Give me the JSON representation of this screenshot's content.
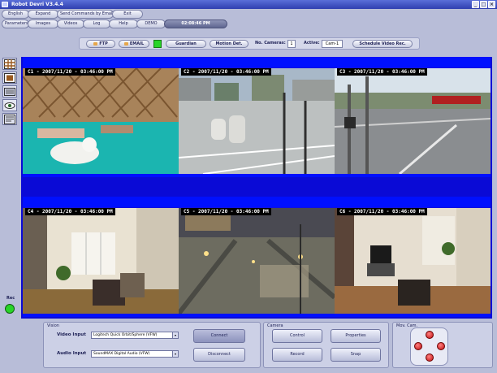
{
  "window": {
    "title": "Robot Devri V3.4.4",
    "controls": [
      "_",
      "□",
      "×"
    ]
  },
  "menu_row1": [
    "English",
    "Expand",
    "Send Commands by Email",
    "Exit"
  ],
  "menu_row2": [
    "Parameters",
    "Images",
    "Videos",
    "Log",
    "Help",
    "DEMO",
    "02:08:46 PM"
  ],
  "toolbar": {
    "ftp": "FTP",
    "email": "EMAIL",
    "guardian": "Guardian",
    "motion": "Motion Det.",
    "num_cameras_label": "No. Cameras:",
    "num_cameras_value": "1",
    "active_label": "Active:",
    "active_value": "Cam-1",
    "schedule": "Schedule Video Rec.",
    "status_color": "#28d428"
  },
  "left_tools": [
    "grid-view-icon",
    "single-view-icon",
    "camera-icon",
    "eye-icon",
    "monitor-icon"
  ],
  "rec": {
    "label": "Rec",
    "color": "#28d428"
  },
  "cameras": [
    {
      "label": "C1 - 2007/11/20 - 03:46:00 PM"
    },
    {
      "label": "C2 - 2007/11/20 - 03:46:00 PM"
    },
    {
      "label": "C3 - 2007/11/20 - 03:46:00 PM"
    },
    {
      "label": "C4 - 2007/11/20 - 03:46:00 PM"
    },
    {
      "label": "C5 - 2007/11/20 - 03:46:00 PM"
    },
    {
      "label": "C6 - 2007/11/20 - 03:46:00 PM"
    }
  ],
  "vision": {
    "title": "Vision",
    "video_input_label": "Video Input",
    "video_input_value": "Logitech Quick Orbit/Sphere (VFW)",
    "audio_input_label": "Audio Input",
    "audio_input_value": "SoundMAX Digital Audio (VFW)",
    "connect": "Connect",
    "disconnect": "Disconnect"
  },
  "camera_panel": {
    "title": "Camera",
    "control": "Control",
    "properties": "Properties",
    "record": "Record",
    "snap": "Snap"
  },
  "movcam": {
    "title": "Mov. Cam."
  }
}
